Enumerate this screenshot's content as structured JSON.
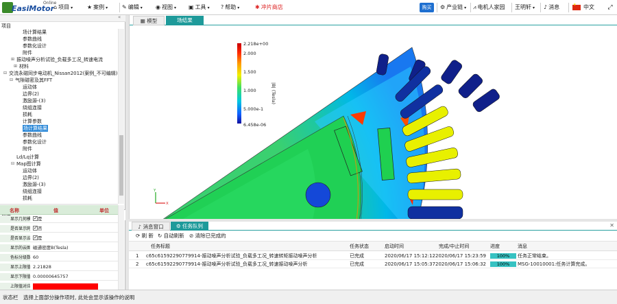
{
  "logo": {
    "text": "EasiMotor",
    "sup": "Online"
  },
  "menu": {
    "project": "项目",
    "case": "案例",
    "edit": "编辑",
    "view": "视图",
    "tools": "工具",
    "help": "帮助",
    "chip_store": "冲片商店",
    "buy": "购买",
    "industry_chain": "产业链",
    "motor_home": "电机人家园",
    "user": "王明轩",
    "messages": "消息",
    "language": "中文"
  },
  "left_panel": {
    "project_title": "项目",
    "tree": [
      {
        "label": "场计算结果"
      },
      {
        "label": "参数曲线"
      },
      {
        "label": "参数化设计"
      },
      {
        "label": "附件"
      },
      {
        "label": "振动噪声分析试验_负载多工况_转速电流"
      },
      {
        "label": "材料"
      },
      {
        "label": "交流永磁同步电动机_Nissan2012(案例_不可编辑)"
      },
      {
        "label": "气隙磁密及其FFT"
      },
      {
        "label": "运动体"
      },
      {
        "label": "边界(2)"
      },
      {
        "label": "激励源-(3)"
      },
      {
        "label": "绕组连接"
      },
      {
        "label": "损耗"
      },
      {
        "label": "计算参数"
      },
      {
        "label": "场计算结果"
      },
      {
        "label": "参数曲线"
      },
      {
        "label": "参数化设计"
      },
      {
        "label": "附件"
      },
      {
        "label": "Ld/Lq计算"
      },
      {
        "label": "Map图计算"
      },
      {
        "label": "运动体"
      },
      {
        "label": "边界(2)"
      },
      {
        "label": "激励源-(3)"
      },
      {
        "label": "绕组连接"
      },
      {
        "label": "损耗"
      }
    ],
    "props_title": "属性",
    "props_headers": {
      "name": "名称",
      "value": "值",
      "unit": "单位"
    },
    "props": [
      {
        "name": "显示几何模型",
        "value": "是"
      },
      {
        "name": "是否显示网格",
        "value": "否"
      },
      {
        "name": "是否显示云图",
        "value": "是"
      },
      {
        "name": "显示的云图量",
        "value": "磁通密度B(Tesla)"
      },
      {
        "name": "色标分级数",
        "value": "60"
      },
      {
        "name": "显示上限值",
        "value": "2.21828"
      },
      {
        "name": "显示下限值",
        "value": "0.00000645757"
      },
      {
        "name": "上限值对应颜色",
        "value": ""
      }
    ]
  },
  "viewer": {
    "tabs": [
      "模型",
      "场结果"
    ],
    "active_tab": "场结果",
    "colorbar": {
      "title": "|B| (Tesla)",
      "labels": [
        "2.218e+00",
        "2.000",
        "1.500",
        "1.000",
        "5.000e-1",
        "6.458e-06"
      ]
    },
    "axes": {
      "y": "Y",
      "x": "X"
    }
  },
  "bottom": {
    "tabs": [
      "消息窗口",
      "任务队列"
    ],
    "active_tab": "任务队列",
    "toolbar": {
      "refresh": "刷 新",
      "auto_refresh": "自动刷新",
      "clear_done": "清除已完成的"
    },
    "columns": {
      "title": "任务标题",
      "status": "任务状态",
      "start": "启动时间",
      "end": "完成/中止时间",
      "progress": "进度",
      "msg": "消息"
    },
    "rows": [
      {
        "idx": "1",
        "title": "c65c61592290779914-振动噪声分析试验_负载多工况_转速转矩振动噪声分析",
        "status": "已完成",
        "start": "2020/06/17 15:12:12",
        "end": "2020/06/17 15:23:59",
        "progress": 100,
        "progress_label": "100%",
        "msg": "任务正常结束。"
      },
      {
        "idx": "2",
        "title": "c65c61592290779914-振动噪声分析试验_负载多工况_转速振动噪声分析",
        "status": "已完成",
        "start": "2020/06/17 15:05:37",
        "end": "2020/06/17 15:06:32",
        "progress": 100,
        "progress_label": "100%",
        "msg": "MSG-10010001:任务计算完成。"
      }
    ]
  },
  "status": {
    "label": "状态栏",
    "text": "选择上面部分操作项时, 此处会显示该操作的说明"
  },
  "colors": {
    "accent": "#1e9a9a",
    "selection": "#2f8ad8",
    "upper_color": "#ff0000",
    "buy": "#1e6fd0"
  }
}
